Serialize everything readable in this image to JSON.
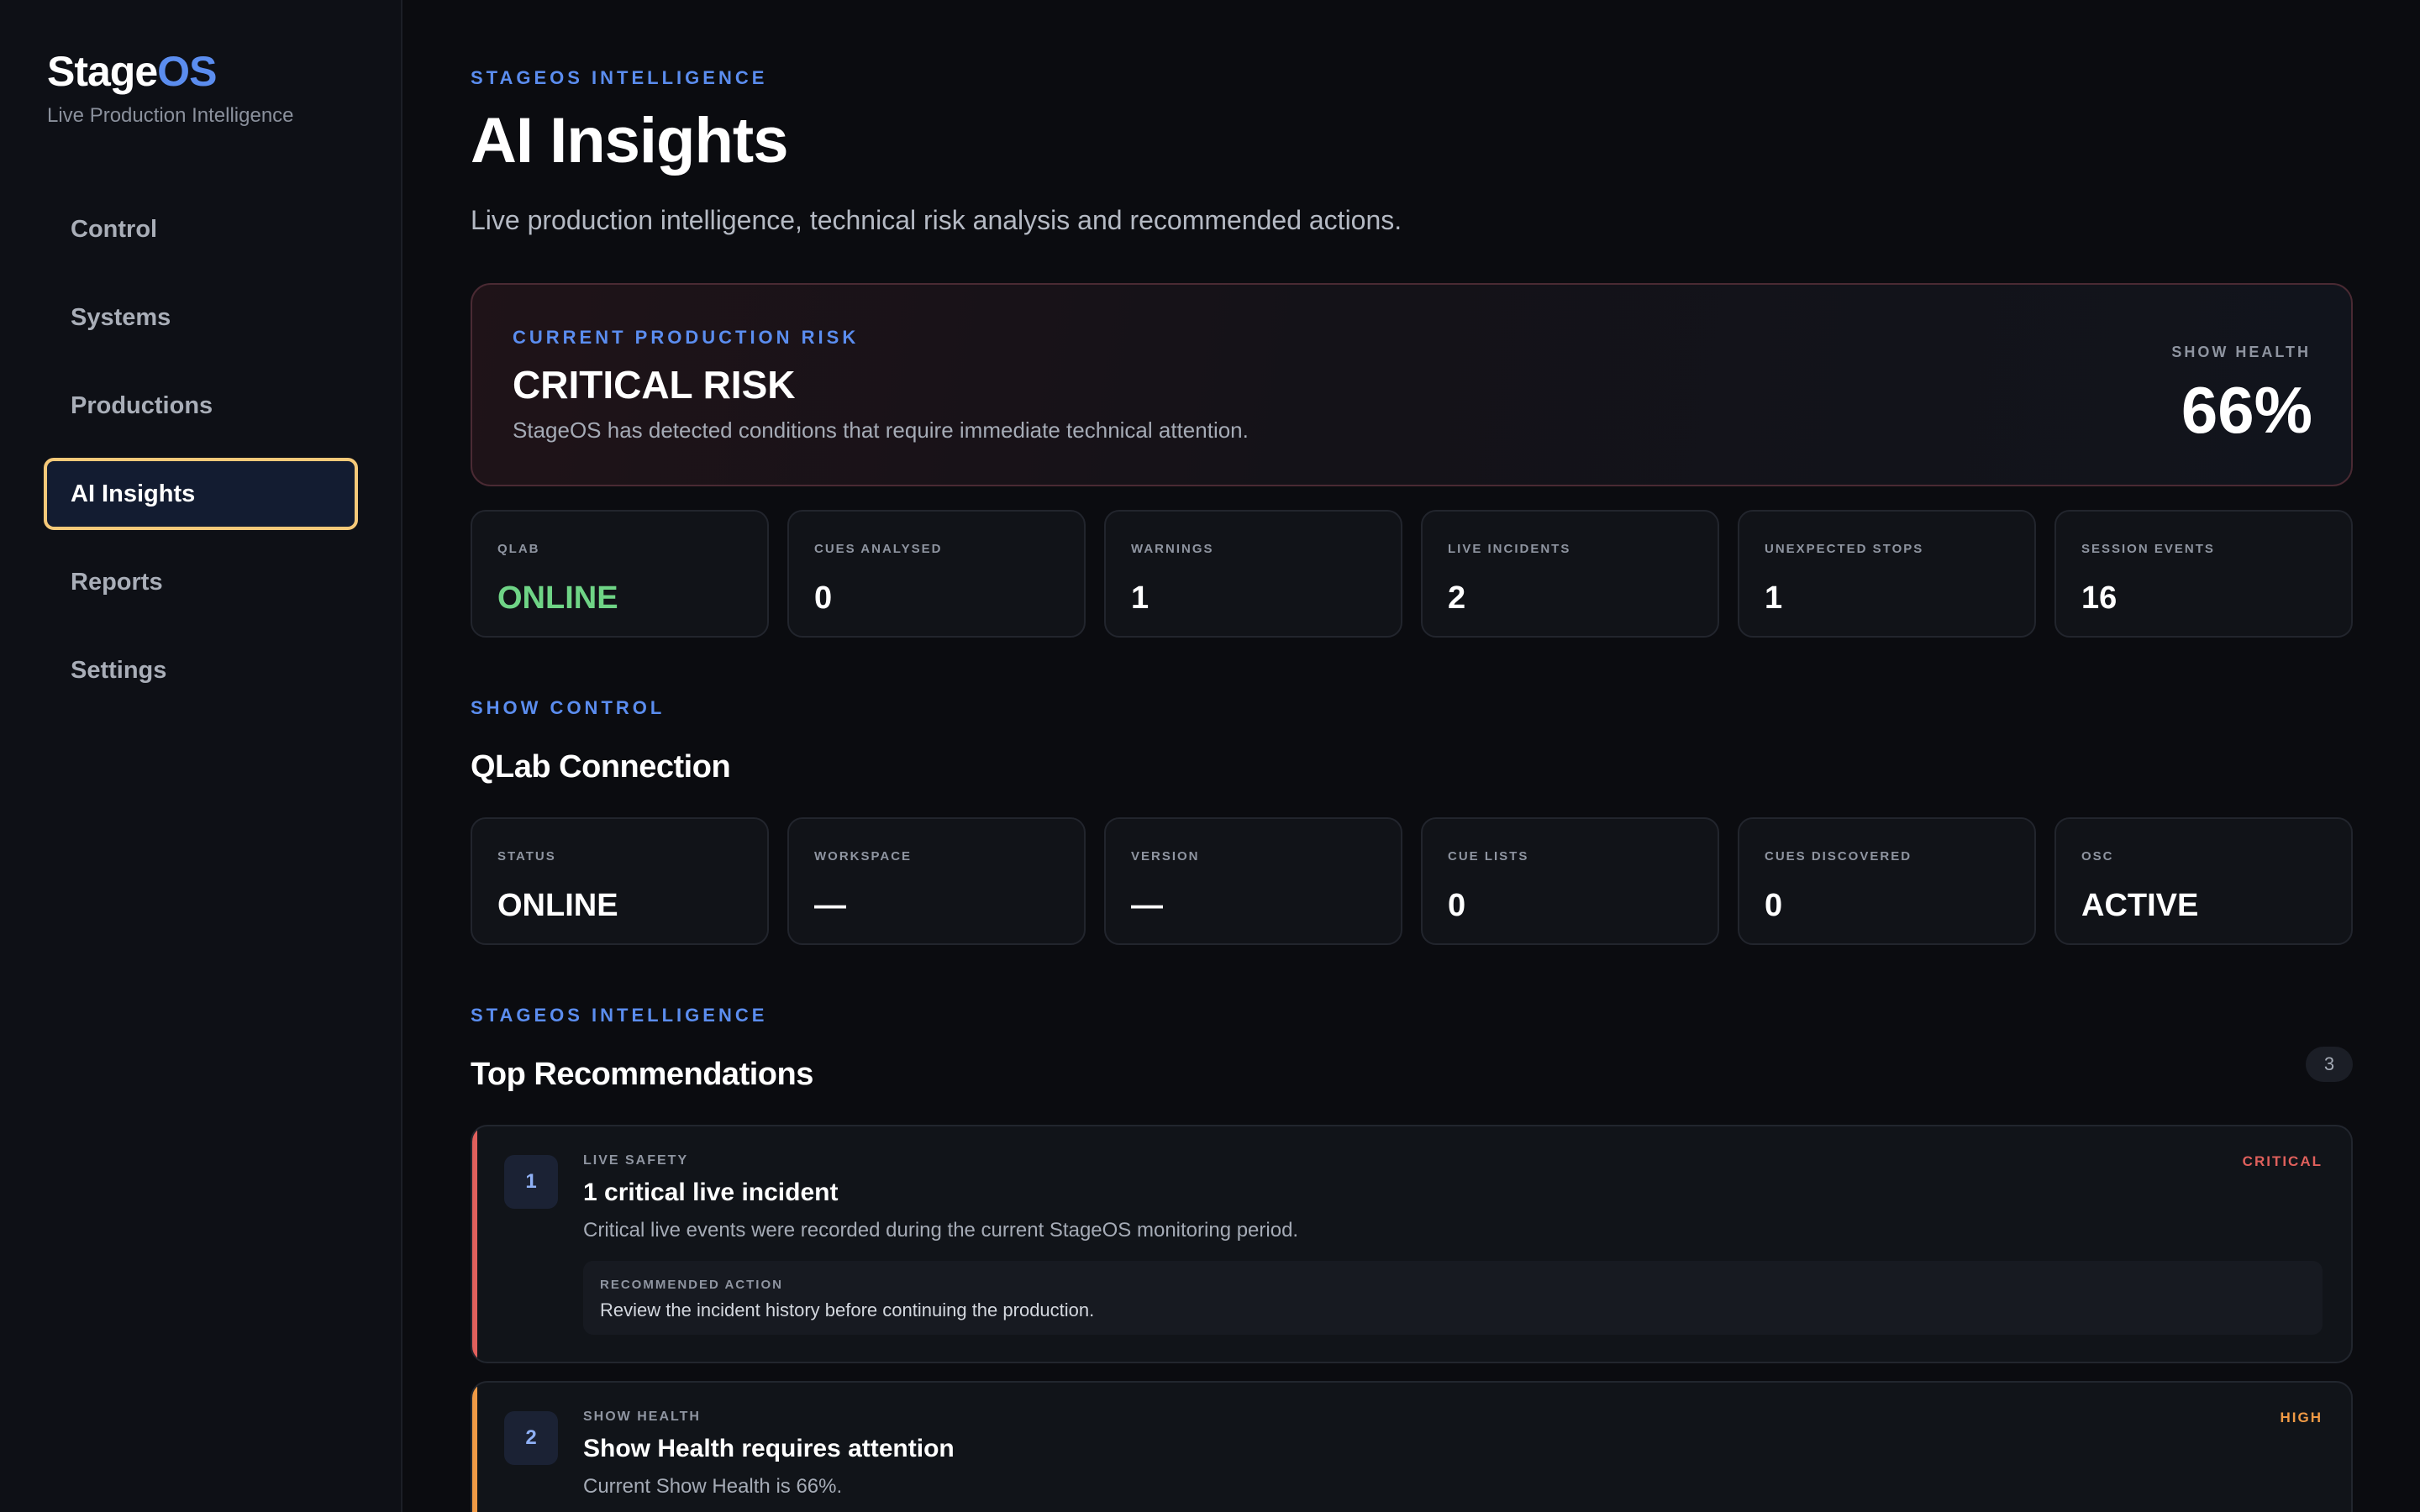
{
  "brand": {
    "name_main": "Stage",
    "name_accent": "OS",
    "subtitle": "Live Production Intelligence"
  },
  "nav": {
    "items": [
      {
        "label": "Control",
        "active": false
      },
      {
        "label": "Systems",
        "active": false
      },
      {
        "label": "Productions",
        "active": false
      },
      {
        "label": "AI Insights",
        "active": true
      },
      {
        "label": "Reports",
        "active": false
      },
      {
        "label": "Settings",
        "active": false
      }
    ]
  },
  "page": {
    "eyebrow": "STAGEOS INTELLIGENCE",
    "title": "AI Insights",
    "subtitle": "Live production intelligence, technical risk analysis and recommended actions."
  },
  "risk": {
    "eyebrow": "CURRENT PRODUCTION RISK",
    "title": "CRITICAL RISK",
    "description": "StageOS has detected conditions that require immediate technical attention.",
    "health_label": "SHOW HEALTH",
    "health_value": "66%"
  },
  "stats": [
    {
      "label": "QLAB",
      "value": "ONLINE"
    },
    {
      "label": "CUES ANALYSED",
      "value": "0"
    },
    {
      "label": "WARNINGS",
      "value": "1"
    },
    {
      "label": "LIVE INCIDENTS",
      "value": "2"
    },
    {
      "label": "UNEXPECTED STOPS",
      "value": "1"
    },
    {
      "label": "SESSION EVENTS",
      "value": "16"
    }
  ],
  "show_control": {
    "eyebrow": "SHOW CONTROL",
    "title": "QLab Connection",
    "stats": [
      {
        "label": "STATUS",
        "value": "ONLINE"
      },
      {
        "label": "WORKSPACE",
        "value": "—"
      },
      {
        "label": "VERSION",
        "value": "—"
      },
      {
        "label": "CUE LISTS",
        "value": "0"
      },
      {
        "label": "CUES DISCOVERED",
        "value": "0"
      },
      {
        "label": "OSC",
        "value": "ACTIVE"
      }
    ]
  },
  "recommendations": {
    "eyebrow": "STAGEOS INTELLIGENCE",
    "title": "Top Recommendations",
    "count": "3",
    "items": [
      {
        "number": "1",
        "category": "LIVE SAFETY",
        "title": "1 critical live incident",
        "description": "Critical live events were recorded during the current StageOS monitoring period.",
        "severity": "CRITICAL",
        "severity_color": "#e0605c",
        "action_label": "RECOMMENDED ACTION",
        "action_text": "Review the incident history before continuing the production."
      },
      {
        "number": "2",
        "category": "SHOW HEALTH",
        "title": "Show Health requires attention",
        "description": "Current Show Health is 66%.",
        "severity": "HIGH",
        "severity_color": "#f09a45"
      }
    ]
  },
  "colors": {
    "accent": "#5b8def",
    "active_border": "#f5c979",
    "online": "#6fd486",
    "critical": "#e0605c",
    "high": "#f09a45"
  }
}
